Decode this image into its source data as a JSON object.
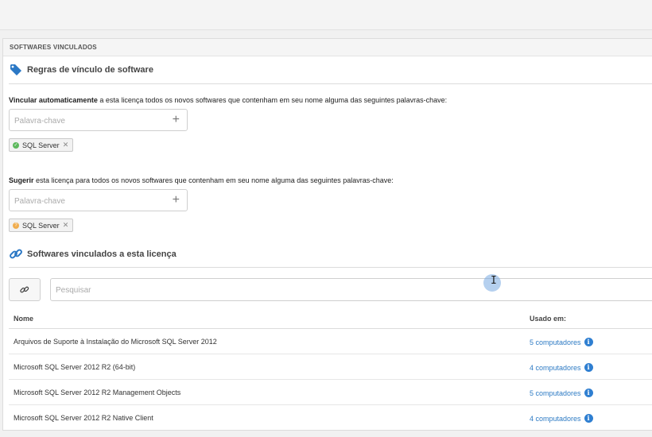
{
  "panel": {
    "header": "SOFTWARES VINCULADOS"
  },
  "rules": {
    "title": "Regras de vínculo de software",
    "auto": {
      "bold": "Vincular automaticamente",
      "rest": " a esta licença todos os novos softwares que contenham em seu nome alguma das seguintes palavras-chave:",
      "placeholder": "Palavra-chave",
      "add_icon": "plus-icon",
      "tag": {
        "label": "SQL Server",
        "status_color": "#5cb85c",
        "status_icon": "check-icon"
      }
    },
    "suggest": {
      "bold": "Sugerir",
      "rest": " esta licença para todos os novos softwares que contenham em seu nome alguma das seguintes palavras-chave:",
      "placeholder": "Palavra-chave",
      "add_icon": "plus-icon",
      "tag": {
        "label": "SQL Server",
        "status_color": "#f0ad4e",
        "status_icon": "question-icon"
      }
    }
  },
  "linked": {
    "title": "Softwares vinculados a esta licença",
    "search_placeholder": "Pesquisar",
    "link_button_icon": "link-icon",
    "columns": {
      "name": "Nome",
      "used": "Usado em:"
    },
    "rows": [
      {
        "name": "Arquivos de Suporte à Instalação do Microsoft SQL Server 2012",
        "used": "5 computadores"
      },
      {
        "name": "Microsoft SQL Server 2012 R2 (64-bit)",
        "used": "4 computadores"
      },
      {
        "name": "Microsoft SQL Server 2012 R2 Management Objects",
        "used": "5 computadores"
      },
      {
        "name": "Microsoft SQL Server 2012 R2 Native Client",
        "used": "4 computadores"
      }
    ]
  },
  "colors": {
    "accent": "#2e7bc4",
    "tag_icon": "#2b78c5",
    "info": "#2f7fd1"
  }
}
